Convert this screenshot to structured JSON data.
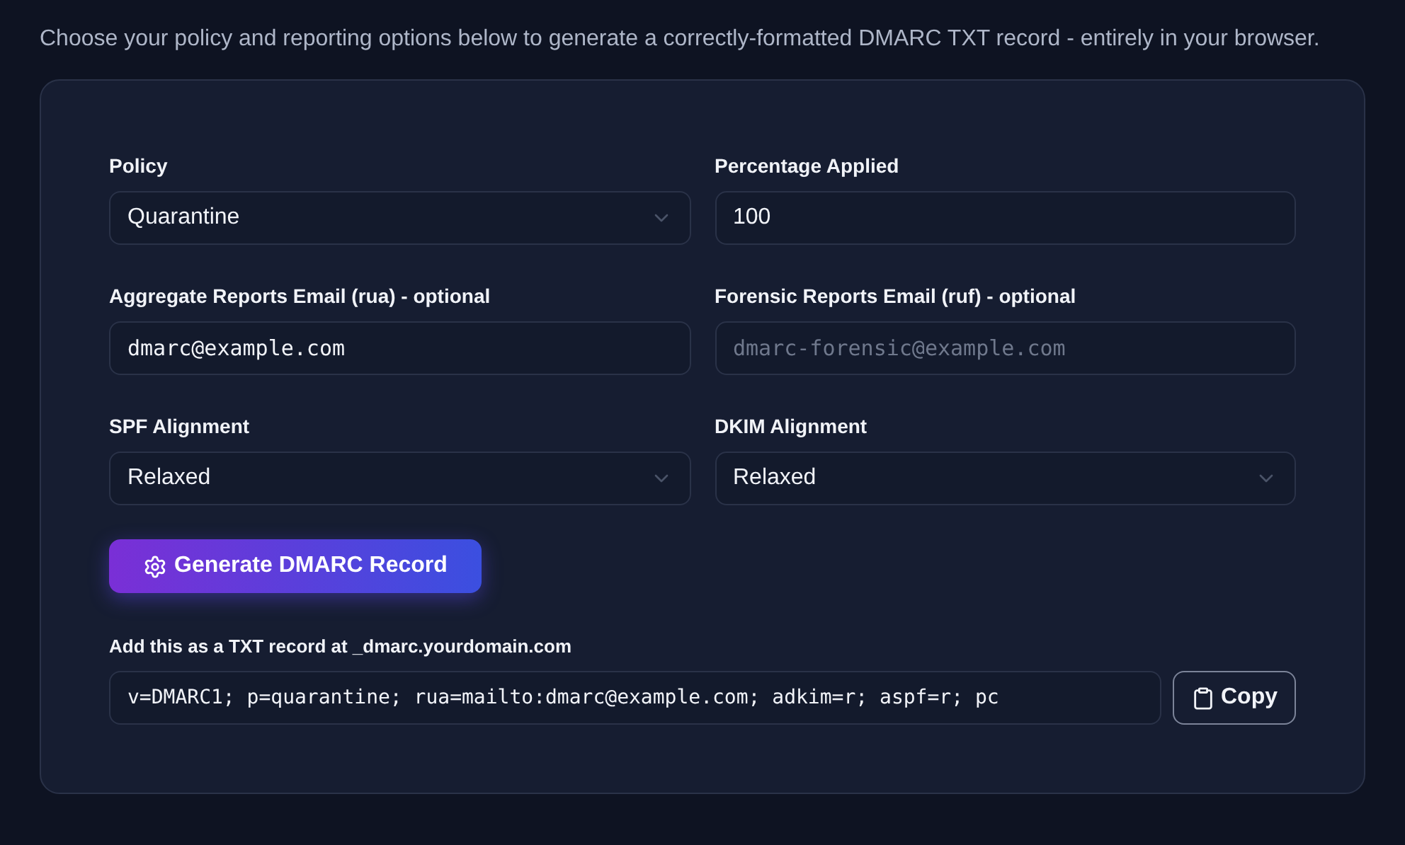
{
  "intro": "Choose your policy and reporting options below to generate a correctly-formatted DMARC TXT record - entirely in your browser.",
  "fields": [
    {
      "label": "Policy",
      "kind": "select",
      "value": "Quarantine"
    },
    {
      "label": "Percentage Applied",
      "kind": "input",
      "value": "100"
    },
    {
      "label": "Aggregate Reports Email (rua) - optional",
      "kind": "email",
      "value": "dmarc@example.com"
    },
    {
      "label": "Forensic Reports Email (ruf) - optional",
      "kind": "email",
      "placeholder": "dmarc-forensic@example.com"
    },
    {
      "label": "SPF Alignment",
      "kind": "select",
      "value": "Relaxed"
    },
    {
      "label": "DKIM Alignment",
      "kind": "select",
      "value": "Relaxed"
    }
  ],
  "generate_button": "Generate DMARC Record",
  "output": {
    "label": "Add this as a TXT record at _dmarc.yourdomain.com",
    "value": "v=DMARC1; p=quarantine; rua=mailto:dmarc@example.com; adkim=r; aspf=r; pc",
    "copy_button": "Copy"
  }
}
